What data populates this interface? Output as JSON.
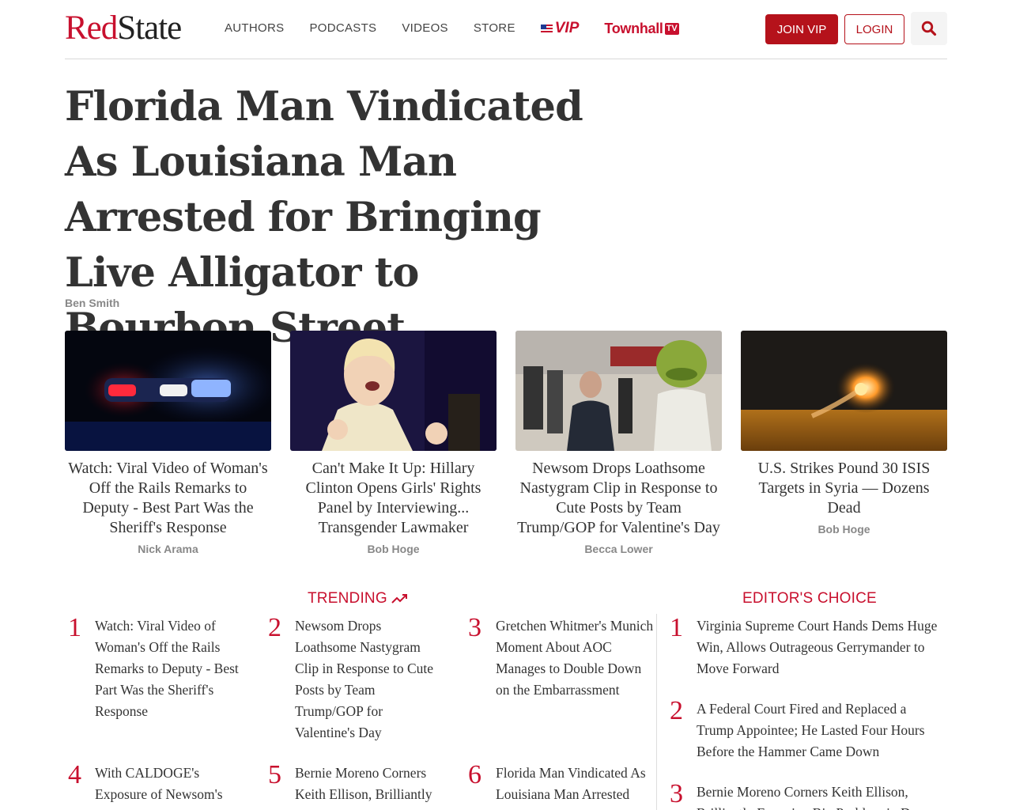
{
  "header": {
    "logo_red": "Red",
    "logo_dark": "State",
    "nav": [
      "AUTHORS",
      "PODCASTS",
      "VIDEOS",
      "STORE"
    ],
    "vip_label": "VIP",
    "townhall_label": "Townhall",
    "tv_label": "TV",
    "join_label": "JOIN VIP",
    "login_label": "LOGIN",
    "search_icon": "search-icon"
  },
  "article": {
    "title": "Florida Man Vindicated As Louisiana Man Arrested for Bringing Live Alligator to Bourbon Street",
    "author": "Ben Smith"
  },
  "cards": [
    {
      "title": "Watch: Viral Video of Woman's Off the Rails Remarks to Deputy - Best Part Was the Sheriff's Response",
      "author": "Nick Arama"
    },
    {
      "title": "Can't Make It Up: Hillary Clinton Opens Girls' Rights Panel by Interviewing... Transgender Lawmaker",
      "author": "Bob Hoge"
    },
    {
      "title": "Newsom Drops Loathsome Nastygram Clip in Response to Cute Posts by Team Trump/GOP for Valentine's Day",
      "author": "Becca Lower"
    },
    {
      "title": "U.S. Strikes Pound 30 ISIS Targets in Syria — Dozens Dead",
      "author": "Bob Hoge"
    }
  ],
  "trending": {
    "title": "TRENDING",
    "items": [
      {
        "num": "1",
        "text": "Watch: Viral Video of Woman's Off the Rails Remarks to Deputy - Best Part Was the Sheriff's Response"
      },
      {
        "num": "2",
        "text": "Newsom Drops Loathsome Nastygram Clip in Response to Cute Posts by Team Trump/GOP for Valentine's Day"
      },
      {
        "num": "3",
        "text": "Gretchen Whitmer's Munich Moment About AOC Manages to Double Down on the Embarrassment"
      },
      {
        "num": "4",
        "text": "With CALDOGE's Exposure of Newsom's Corruption Fraud, Spoon"
      },
      {
        "num": "5",
        "text": "Bernie Moreno Corners Keith Ellison, Brilliantly Exposing Big Problem in"
      },
      {
        "num": "6",
        "text": "Florida Man Vindicated As Louisiana Man Arrested for Bringing"
      }
    ]
  },
  "editors_choice": {
    "title": "EDITOR'S CHOICE",
    "items": [
      {
        "num": "1",
        "text": "Virginia Supreme Court Hands Dems Huge Win, Allows Outrageous Gerrymander to Move Forward"
      },
      {
        "num": "2",
        "text": "A Federal Court Fired and Replaced a Trump Appointee; He Lasted Four Hours Before the Hammer Came Down"
      },
      {
        "num": "3",
        "text": "Bernie Moreno Corners Keith Ellison, Brilliantly Exposing Big Problem in Dem"
      }
    ]
  },
  "colors": {
    "brand_red": "#c8102e",
    "button_red": "#b5121b"
  }
}
